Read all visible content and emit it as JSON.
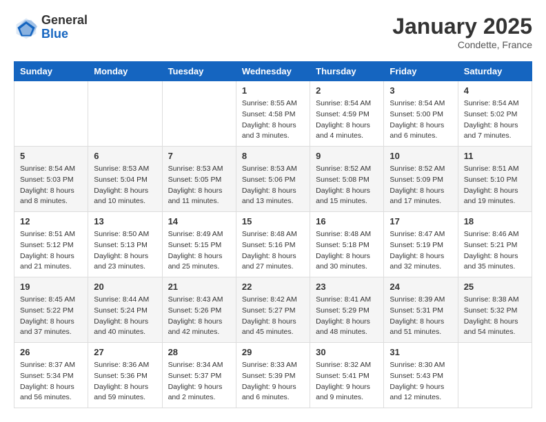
{
  "header": {
    "logo_general": "General",
    "logo_blue": "Blue",
    "month_year": "January 2025",
    "location": "Condette, France"
  },
  "weekdays": [
    "Sunday",
    "Monday",
    "Tuesday",
    "Wednesday",
    "Thursday",
    "Friday",
    "Saturday"
  ],
  "weeks": [
    [
      {
        "day": "",
        "info": ""
      },
      {
        "day": "",
        "info": ""
      },
      {
        "day": "",
        "info": ""
      },
      {
        "day": "1",
        "info": "Sunrise: 8:55 AM\nSunset: 4:58 PM\nDaylight: 8 hours\nand 3 minutes."
      },
      {
        "day": "2",
        "info": "Sunrise: 8:54 AM\nSunset: 4:59 PM\nDaylight: 8 hours\nand 4 minutes."
      },
      {
        "day": "3",
        "info": "Sunrise: 8:54 AM\nSunset: 5:00 PM\nDaylight: 8 hours\nand 6 minutes."
      },
      {
        "day": "4",
        "info": "Sunrise: 8:54 AM\nSunset: 5:02 PM\nDaylight: 8 hours\nand 7 minutes."
      }
    ],
    [
      {
        "day": "5",
        "info": "Sunrise: 8:54 AM\nSunset: 5:03 PM\nDaylight: 8 hours\nand 8 minutes."
      },
      {
        "day": "6",
        "info": "Sunrise: 8:53 AM\nSunset: 5:04 PM\nDaylight: 8 hours\nand 10 minutes."
      },
      {
        "day": "7",
        "info": "Sunrise: 8:53 AM\nSunset: 5:05 PM\nDaylight: 8 hours\nand 11 minutes."
      },
      {
        "day": "8",
        "info": "Sunrise: 8:53 AM\nSunset: 5:06 PM\nDaylight: 8 hours\nand 13 minutes."
      },
      {
        "day": "9",
        "info": "Sunrise: 8:52 AM\nSunset: 5:08 PM\nDaylight: 8 hours\nand 15 minutes."
      },
      {
        "day": "10",
        "info": "Sunrise: 8:52 AM\nSunset: 5:09 PM\nDaylight: 8 hours\nand 17 minutes."
      },
      {
        "day": "11",
        "info": "Sunrise: 8:51 AM\nSunset: 5:10 PM\nDaylight: 8 hours\nand 19 minutes."
      }
    ],
    [
      {
        "day": "12",
        "info": "Sunrise: 8:51 AM\nSunset: 5:12 PM\nDaylight: 8 hours\nand 21 minutes."
      },
      {
        "day": "13",
        "info": "Sunrise: 8:50 AM\nSunset: 5:13 PM\nDaylight: 8 hours\nand 23 minutes."
      },
      {
        "day": "14",
        "info": "Sunrise: 8:49 AM\nSunset: 5:15 PM\nDaylight: 8 hours\nand 25 minutes."
      },
      {
        "day": "15",
        "info": "Sunrise: 8:48 AM\nSunset: 5:16 PM\nDaylight: 8 hours\nand 27 minutes."
      },
      {
        "day": "16",
        "info": "Sunrise: 8:48 AM\nSunset: 5:18 PM\nDaylight: 8 hours\nand 30 minutes."
      },
      {
        "day": "17",
        "info": "Sunrise: 8:47 AM\nSunset: 5:19 PM\nDaylight: 8 hours\nand 32 minutes."
      },
      {
        "day": "18",
        "info": "Sunrise: 8:46 AM\nSunset: 5:21 PM\nDaylight: 8 hours\nand 35 minutes."
      }
    ],
    [
      {
        "day": "19",
        "info": "Sunrise: 8:45 AM\nSunset: 5:22 PM\nDaylight: 8 hours\nand 37 minutes."
      },
      {
        "day": "20",
        "info": "Sunrise: 8:44 AM\nSunset: 5:24 PM\nDaylight: 8 hours\nand 40 minutes."
      },
      {
        "day": "21",
        "info": "Sunrise: 8:43 AM\nSunset: 5:26 PM\nDaylight: 8 hours\nand 42 minutes."
      },
      {
        "day": "22",
        "info": "Sunrise: 8:42 AM\nSunset: 5:27 PM\nDaylight: 8 hours\nand 45 minutes."
      },
      {
        "day": "23",
        "info": "Sunrise: 8:41 AM\nSunset: 5:29 PM\nDaylight: 8 hours\nand 48 minutes."
      },
      {
        "day": "24",
        "info": "Sunrise: 8:39 AM\nSunset: 5:31 PM\nDaylight: 8 hours\nand 51 minutes."
      },
      {
        "day": "25",
        "info": "Sunrise: 8:38 AM\nSunset: 5:32 PM\nDaylight: 8 hours\nand 54 minutes."
      }
    ],
    [
      {
        "day": "26",
        "info": "Sunrise: 8:37 AM\nSunset: 5:34 PM\nDaylight: 8 hours\nand 56 minutes."
      },
      {
        "day": "27",
        "info": "Sunrise: 8:36 AM\nSunset: 5:36 PM\nDaylight: 8 hours\nand 59 minutes."
      },
      {
        "day": "28",
        "info": "Sunrise: 8:34 AM\nSunset: 5:37 PM\nDaylight: 9 hours\nand 2 minutes."
      },
      {
        "day": "29",
        "info": "Sunrise: 8:33 AM\nSunset: 5:39 PM\nDaylight: 9 hours\nand 6 minutes."
      },
      {
        "day": "30",
        "info": "Sunrise: 8:32 AM\nSunset: 5:41 PM\nDaylight: 9 hours\nand 9 minutes."
      },
      {
        "day": "31",
        "info": "Sunrise: 8:30 AM\nSunset: 5:43 PM\nDaylight: 9 hours\nand 12 minutes."
      },
      {
        "day": "",
        "info": ""
      }
    ]
  ]
}
